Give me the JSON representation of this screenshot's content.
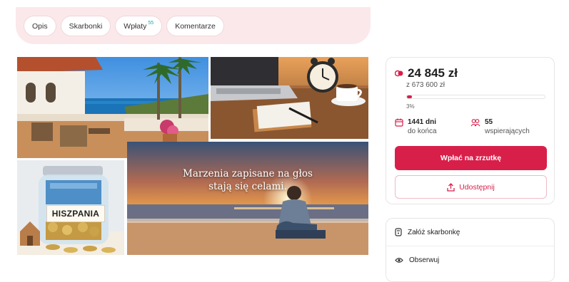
{
  "tabs": [
    {
      "label": "Opis"
    },
    {
      "label": "Skarbonki"
    },
    {
      "label": "Wpłaty",
      "badge": "55"
    },
    {
      "label": "Komentarze"
    }
  ],
  "collage": {
    "quote_line1": "Marzenia zapisane na głos",
    "quote_line2": "stają się celami.",
    "jar_label": "HISZPANIA"
  },
  "fundraiser": {
    "amount": "24 845 zł",
    "goal": "z 673 600 zł",
    "progress_percent_label": "3%",
    "progress_fraction": 0.037,
    "days_value": "1441 dni",
    "days_label": "do końca",
    "supporters_value": "55",
    "supporters_label": "wspierających",
    "donate_label": "Wpłać na zrzutkę",
    "share_label": "Udostępnij"
  },
  "actions": {
    "create_piggybank": "Załóż skarbonkę",
    "follow": "Obserwuj"
  },
  "colors": {
    "accent": "#d81f4a",
    "tab_bar": "#fbe8ea",
    "badge": "#2aa6a3"
  },
  "icons": [
    "coins-icon",
    "calendar-icon",
    "supporters-icon",
    "share-icon",
    "piggybank-icon",
    "eye-icon"
  ]
}
